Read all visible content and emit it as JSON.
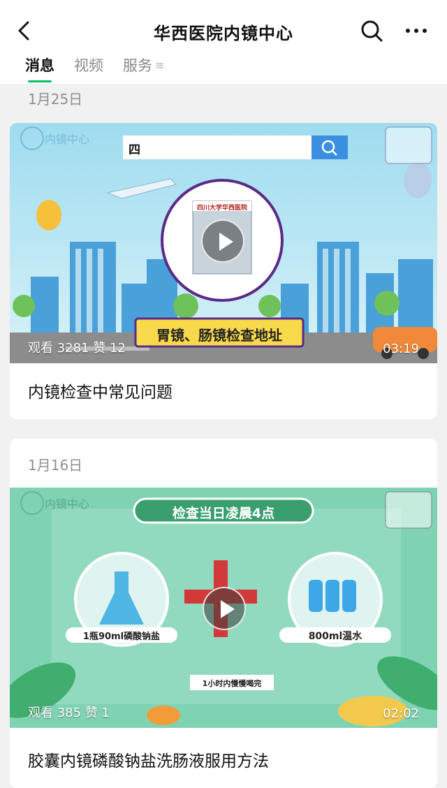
{
  "header": {
    "title": "华西医院内镜中心",
    "back_icon": "chevron-left-icon",
    "search_icon": "search-icon",
    "more_icon": "more-horizontal-icon"
  },
  "tabs": [
    {
      "label": "消息",
      "active": true
    },
    {
      "label": "视频",
      "active": false
    },
    {
      "label": "服务",
      "active": false
    }
  ],
  "tab_menu_icon": "menu-lines-icon",
  "posts": [
    {
      "date": "1月25日",
      "title": "内镜检查中常见问题",
      "views": "观看 3281",
      "likes": "赞 12",
      "duration": "03:19",
      "thumb": {
        "logo": "内镜中心",
        "search_text": "四",
        "building_sign": "四川大学华西医院",
        "caption": "胃镜、肠镜检查地址"
      }
    },
    {
      "date": "1月16日",
      "title": "胶囊内镜磷酸钠盐洗肠液服用方法",
      "views": "观看 385",
      "likes": "赞 1",
      "duration": "02:02",
      "thumb": {
        "logo": "内镜中心",
        "banner": "检查当日凌晨4点",
        "left_label": "1瓶90ml磷酸钠盐",
        "right_label": "800ml温水",
        "bottom_label": "1小时内慢慢喝完"
      }
    }
  ],
  "colors": {
    "accent_tab": "#07c160",
    "thumb1_sky": "#b6e6f5",
    "thumb2_bg": "#7dd1b0",
    "caption_bg": "#f7d94a"
  }
}
